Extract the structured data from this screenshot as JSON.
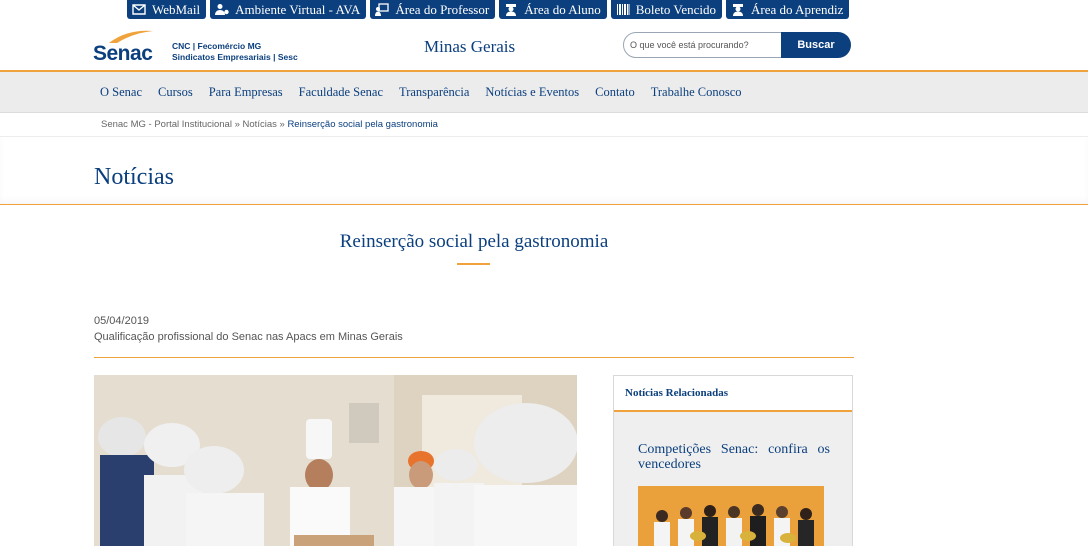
{
  "topbar": {
    "items": [
      {
        "label": "WebMail",
        "icon": "envelope-icon"
      },
      {
        "label": "Ambiente Virtual - AVA",
        "icon": "users-gear-icon"
      },
      {
        "label": "Área do Professor",
        "icon": "teacher-board-icon"
      },
      {
        "label": "Área do Aluno",
        "icon": "student-icon"
      },
      {
        "label": "Boleto Vencido",
        "icon": "barcode-icon"
      },
      {
        "label": "Área do Aprendiz",
        "icon": "apprentice-icon"
      }
    ]
  },
  "header": {
    "logo_text": "Senac",
    "tagline_line1": "CNC | Fecomércio MG",
    "tagline_line2": "Sindicatos Empresariais | Sesc",
    "region": "Minas Gerais",
    "search_placeholder": "O que você está procurando?",
    "search_button": "Buscar"
  },
  "nav": {
    "items": [
      "O Senac",
      "Cursos",
      "Para Empresas",
      "Faculdade Senac",
      "Transparência",
      "Notícias e Eventos",
      "Contato",
      "Trabalhe Conosco"
    ]
  },
  "breadcrumb": {
    "home": "Senac MG - Portal Institucional",
    "sep": "»",
    "section": "Notícias",
    "current": "Reinserção social pela gastronomia"
  },
  "section": {
    "title": "Notícias"
  },
  "article": {
    "title": "Reinserção social pela gastronomia",
    "date": "05/04/2019",
    "subtitle": "Qualificação profissional do Senac nas Apacs em Minas Gerais"
  },
  "related": {
    "heading": "Notícias Relacionadas",
    "items": [
      {
        "title": "Competições Senac: confira os vencedores"
      }
    ]
  },
  "colors": {
    "brand_blue": "#0b3f7e",
    "accent_orange": "#f0a33c",
    "nav_bg": "#ececec"
  }
}
